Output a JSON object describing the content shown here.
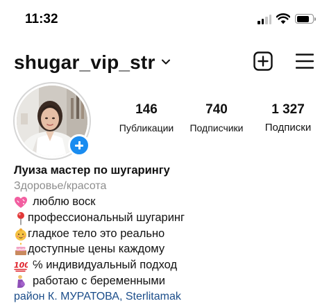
{
  "status_bar": {
    "time": "11:32",
    "icons": [
      "cellular-signal-icon",
      "wifi-icon",
      "battery-icon"
    ]
  },
  "header": {
    "username": "shugar_vip_str",
    "icons": [
      "chevron-down-icon",
      "new-post-icon",
      "menu-icon"
    ]
  },
  "profile": {
    "stats": [
      {
        "value": "146",
        "label": "Публикации"
      },
      {
        "value": "740",
        "label": "Подписчики"
      },
      {
        "value": "1 327",
        "label": "Подписки"
      }
    ]
  },
  "bio": {
    "name": "Луиза мастер по шугарингу",
    "category": "Здоровье/красота",
    "lines": [
      {
        "emoji": "heart-icon",
        "text": "люблю воск"
      },
      {
        "emoji": "pushpin-icon",
        "text": "профессиональный шугаринг"
      },
      {
        "emoji": "baby-face-icon",
        "text": "гладкое тело это реально"
      },
      {
        "emoji": "cake-icon",
        "text": "доступные цены каждому"
      },
      {
        "emoji": "hundred-points-icon",
        "text": "℅ индивидуальный подход"
      },
      {
        "emoji": "pregnant-woman-icon",
        "text": "работаю с беременными"
      }
    ],
    "location": "район К. МУРАТОВА, Sterlitamak"
  },
  "colors": {
    "accent_blue": "#1a8cf0",
    "link_blue": "#1b4d8a",
    "secondary_text": "#8e8e8e"
  }
}
